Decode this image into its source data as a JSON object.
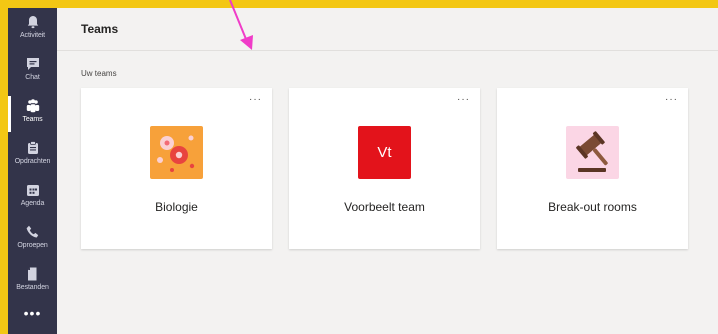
{
  "rail": {
    "items": [
      {
        "label": "Activiteit",
        "icon": "bell-icon"
      },
      {
        "label": "Chat",
        "icon": "chat-icon"
      },
      {
        "label": "Teams",
        "icon": "teams-icon",
        "active": true
      },
      {
        "label": "Opdrachten",
        "icon": "assignments-icon"
      },
      {
        "label": "Agenda",
        "icon": "calendar-icon"
      },
      {
        "label": "Oproepen",
        "icon": "phone-icon"
      },
      {
        "label": "Bestanden",
        "icon": "file-icon"
      }
    ],
    "more_label": "•••"
  },
  "header": {
    "title": "Teams"
  },
  "section_label": "Uw teams",
  "teams": [
    {
      "name": "Biologie",
      "icon": "flower-icon",
      "color": "#f7a13a"
    },
    {
      "name": "Voorbeelt team",
      "initials": "Vt",
      "color": "#e3131b"
    },
    {
      "name": "Break-out rooms",
      "icon": "gavel-icon",
      "color": "#fbd6e5"
    }
  ],
  "card_more_label": "···",
  "colors": {
    "rail": "#33344a",
    "border": "#f3c714",
    "annotation_arrow": "#f03cc8"
  }
}
